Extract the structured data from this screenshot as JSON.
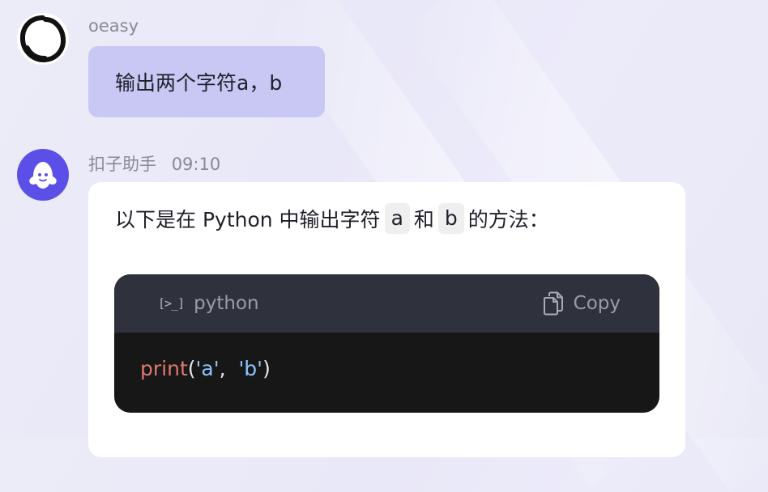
{
  "user_message": {
    "sender": "oeasy",
    "text": "输出两个字符a，b"
  },
  "bot_message": {
    "sender": "扣子助手",
    "time": "09:10",
    "answer": {
      "prefix": "以下是在 Python 中输出字符",
      "code1": "a",
      "mid": "和",
      "code2": "b",
      "suffix": "的方法："
    },
    "code_block": {
      "language": "python",
      "copy_label": "Copy",
      "code": {
        "func": "print",
        "open": "(",
        "arg1": "'a'",
        "sep": ",  ",
        "arg2": "'b'",
        "close": ")"
      }
    }
  },
  "colors": {
    "user_bubble": "#c9c8f5",
    "bot_avatar": "#5b4fe8",
    "code_header": "#2f323c",
    "code_body": "#171717",
    "keyword": "#e0786e",
    "string": "#8fc3ff"
  },
  "icons": {
    "user_avatar": "ink-circle-icon",
    "bot_avatar": "ghost-icon",
    "language": "terminal-icon",
    "copy": "copy-icon"
  }
}
